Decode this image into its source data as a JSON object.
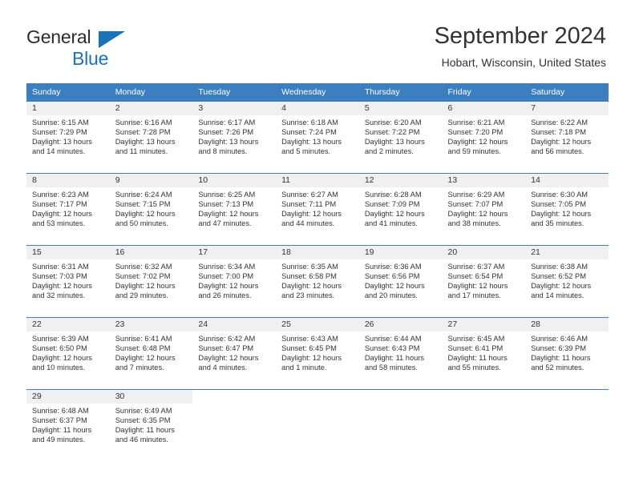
{
  "brand": {
    "name_dark": "General",
    "name_blue": "Blue",
    "accent_color": "#1b72b8"
  },
  "header": {
    "title": "September 2024",
    "subtitle": "Hobart, Wisconsin, United States"
  },
  "theme": {
    "header_row_bg": "#3c7fc1",
    "daynum_band_bg": "#f0f0f0",
    "row_divider": "#3c7fc1",
    "text": "#333333"
  },
  "weekdays": [
    "Sunday",
    "Monday",
    "Tuesday",
    "Wednesday",
    "Thursday",
    "Friday",
    "Saturday"
  ],
  "weeks": [
    [
      {
        "day": "1",
        "sunrise": "Sunrise: 6:15 AM",
        "sunset": "Sunset: 7:29 PM",
        "daylight_line1": "Daylight: 13 hours",
        "daylight_line2": "and 14 minutes."
      },
      {
        "day": "2",
        "sunrise": "Sunrise: 6:16 AM",
        "sunset": "Sunset: 7:28 PM",
        "daylight_line1": "Daylight: 13 hours",
        "daylight_line2": "and 11 minutes."
      },
      {
        "day": "3",
        "sunrise": "Sunrise: 6:17 AM",
        "sunset": "Sunset: 7:26 PM",
        "daylight_line1": "Daylight: 13 hours",
        "daylight_line2": "and 8 minutes."
      },
      {
        "day": "4",
        "sunrise": "Sunrise: 6:18 AM",
        "sunset": "Sunset: 7:24 PM",
        "daylight_line1": "Daylight: 13 hours",
        "daylight_line2": "and 5 minutes."
      },
      {
        "day": "5",
        "sunrise": "Sunrise: 6:20 AM",
        "sunset": "Sunset: 7:22 PM",
        "daylight_line1": "Daylight: 13 hours",
        "daylight_line2": "and 2 minutes."
      },
      {
        "day": "6",
        "sunrise": "Sunrise: 6:21 AM",
        "sunset": "Sunset: 7:20 PM",
        "daylight_line1": "Daylight: 12 hours",
        "daylight_line2": "and 59 minutes."
      },
      {
        "day": "7",
        "sunrise": "Sunrise: 6:22 AM",
        "sunset": "Sunset: 7:18 PM",
        "daylight_line1": "Daylight: 12 hours",
        "daylight_line2": "and 56 minutes."
      }
    ],
    [
      {
        "day": "8",
        "sunrise": "Sunrise: 6:23 AM",
        "sunset": "Sunset: 7:17 PM",
        "daylight_line1": "Daylight: 12 hours",
        "daylight_line2": "and 53 minutes."
      },
      {
        "day": "9",
        "sunrise": "Sunrise: 6:24 AM",
        "sunset": "Sunset: 7:15 PM",
        "daylight_line1": "Daylight: 12 hours",
        "daylight_line2": "and 50 minutes."
      },
      {
        "day": "10",
        "sunrise": "Sunrise: 6:25 AM",
        "sunset": "Sunset: 7:13 PM",
        "daylight_line1": "Daylight: 12 hours",
        "daylight_line2": "and 47 minutes."
      },
      {
        "day": "11",
        "sunrise": "Sunrise: 6:27 AM",
        "sunset": "Sunset: 7:11 PM",
        "daylight_line1": "Daylight: 12 hours",
        "daylight_line2": "and 44 minutes."
      },
      {
        "day": "12",
        "sunrise": "Sunrise: 6:28 AM",
        "sunset": "Sunset: 7:09 PM",
        "daylight_line1": "Daylight: 12 hours",
        "daylight_line2": "and 41 minutes."
      },
      {
        "day": "13",
        "sunrise": "Sunrise: 6:29 AM",
        "sunset": "Sunset: 7:07 PM",
        "daylight_line1": "Daylight: 12 hours",
        "daylight_line2": "and 38 minutes."
      },
      {
        "day": "14",
        "sunrise": "Sunrise: 6:30 AM",
        "sunset": "Sunset: 7:05 PM",
        "daylight_line1": "Daylight: 12 hours",
        "daylight_line2": "and 35 minutes."
      }
    ],
    [
      {
        "day": "15",
        "sunrise": "Sunrise: 6:31 AM",
        "sunset": "Sunset: 7:03 PM",
        "daylight_line1": "Daylight: 12 hours",
        "daylight_line2": "and 32 minutes."
      },
      {
        "day": "16",
        "sunrise": "Sunrise: 6:32 AM",
        "sunset": "Sunset: 7:02 PM",
        "daylight_line1": "Daylight: 12 hours",
        "daylight_line2": "and 29 minutes."
      },
      {
        "day": "17",
        "sunrise": "Sunrise: 6:34 AM",
        "sunset": "Sunset: 7:00 PM",
        "daylight_line1": "Daylight: 12 hours",
        "daylight_line2": "and 26 minutes."
      },
      {
        "day": "18",
        "sunrise": "Sunrise: 6:35 AM",
        "sunset": "Sunset: 6:58 PM",
        "daylight_line1": "Daylight: 12 hours",
        "daylight_line2": "and 23 minutes."
      },
      {
        "day": "19",
        "sunrise": "Sunrise: 6:36 AM",
        "sunset": "Sunset: 6:56 PM",
        "daylight_line1": "Daylight: 12 hours",
        "daylight_line2": "and 20 minutes."
      },
      {
        "day": "20",
        "sunrise": "Sunrise: 6:37 AM",
        "sunset": "Sunset: 6:54 PM",
        "daylight_line1": "Daylight: 12 hours",
        "daylight_line2": "and 17 minutes."
      },
      {
        "day": "21",
        "sunrise": "Sunrise: 6:38 AM",
        "sunset": "Sunset: 6:52 PM",
        "daylight_line1": "Daylight: 12 hours",
        "daylight_line2": "and 14 minutes."
      }
    ],
    [
      {
        "day": "22",
        "sunrise": "Sunrise: 6:39 AM",
        "sunset": "Sunset: 6:50 PM",
        "daylight_line1": "Daylight: 12 hours",
        "daylight_line2": "and 10 minutes."
      },
      {
        "day": "23",
        "sunrise": "Sunrise: 6:41 AM",
        "sunset": "Sunset: 6:48 PM",
        "daylight_line1": "Daylight: 12 hours",
        "daylight_line2": "and 7 minutes."
      },
      {
        "day": "24",
        "sunrise": "Sunrise: 6:42 AM",
        "sunset": "Sunset: 6:47 PM",
        "daylight_line1": "Daylight: 12 hours",
        "daylight_line2": "and 4 minutes."
      },
      {
        "day": "25",
        "sunrise": "Sunrise: 6:43 AM",
        "sunset": "Sunset: 6:45 PM",
        "daylight_line1": "Daylight: 12 hours",
        "daylight_line2": "and 1 minute."
      },
      {
        "day": "26",
        "sunrise": "Sunrise: 6:44 AM",
        "sunset": "Sunset: 6:43 PM",
        "daylight_line1": "Daylight: 11 hours",
        "daylight_line2": "and 58 minutes."
      },
      {
        "day": "27",
        "sunrise": "Sunrise: 6:45 AM",
        "sunset": "Sunset: 6:41 PM",
        "daylight_line1": "Daylight: 11 hours",
        "daylight_line2": "and 55 minutes."
      },
      {
        "day": "28",
        "sunrise": "Sunrise: 6:46 AM",
        "sunset": "Sunset: 6:39 PM",
        "daylight_line1": "Daylight: 11 hours",
        "daylight_line2": "and 52 minutes."
      }
    ],
    [
      {
        "day": "29",
        "sunrise": "Sunrise: 6:48 AM",
        "sunset": "Sunset: 6:37 PM",
        "daylight_line1": "Daylight: 11 hours",
        "daylight_line2": "and 49 minutes."
      },
      {
        "day": "30",
        "sunrise": "Sunrise: 6:49 AM",
        "sunset": "Sunset: 6:35 PM",
        "daylight_line1": "Daylight: 11 hours",
        "daylight_line2": "and 46 minutes."
      },
      {
        "day": "",
        "sunrise": "",
        "sunset": "",
        "daylight_line1": "",
        "daylight_line2": ""
      },
      {
        "day": "",
        "sunrise": "",
        "sunset": "",
        "daylight_line1": "",
        "daylight_line2": ""
      },
      {
        "day": "",
        "sunrise": "",
        "sunset": "",
        "daylight_line1": "",
        "daylight_line2": ""
      },
      {
        "day": "",
        "sunrise": "",
        "sunset": "",
        "daylight_line1": "",
        "daylight_line2": ""
      },
      {
        "day": "",
        "sunrise": "",
        "sunset": "",
        "daylight_line1": "",
        "daylight_line2": ""
      }
    ]
  ]
}
